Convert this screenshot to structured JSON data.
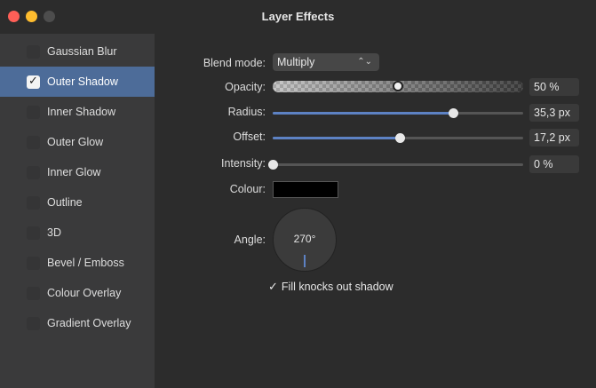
{
  "window": {
    "title": "Layer Effects"
  },
  "sidebar": {
    "items": [
      {
        "label": "Gaussian Blur",
        "checked": false,
        "selected": false
      },
      {
        "label": "Outer Shadow",
        "checked": true,
        "selected": true
      },
      {
        "label": "Inner Shadow",
        "checked": false,
        "selected": false
      },
      {
        "label": "Outer Glow",
        "checked": false,
        "selected": false
      },
      {
        "label": "Inner Glow",
        "checked": false,
        "selected": false
      },
      {
        "label": "Outline",
        "checked": false,
        "selected": false
      },
      {
        "label": "3D",
        "checked": false,
        "selected": false
      },
      {
        "label": "Bevel / Emboss",
        "checked": false,
        "selected": false
      },
      {
        "label": "Colour Overlay",
        "checked": false,
        "selected": false
      },
      {
        "label": "Gradient Overlay",
        "checked": false,
        "selected": false
      }
    ]
  },
  "settings": {
    "blend_mode": {
      "label": "Blend mode:",
      "value": "Multiply"
    },
    "opacity": {
      "label": "Opacity:",
      "value": "50 %",
      "fraction": 0.5
    },
    "radius": {
      "label": "Radius:",
      "value": "35,3 px",
      "fraction": 0.72
    },
    "offset": {
      "label": "Offset:",
      "value": "17,2 px",
      "fraction": 0.51
    },
    "intensity": {
      "label": "Intensity:",
      "value": "0 %",
      "fraction": 0.0
    },
    "colour": {
      "label": "Colour:",
      "value": "#000000"
    },
    "angle": {
      "label": "Angle:",
      "value": "270°"
    },
    "fill_knocks_out": {
      "label": "Fill knocks out shadow",
      "checked": true
    }
  },
  "colors": {
    "accent": "#5d82c4",
    "selection": "#4d6c99",
    "close": "#ff5f57",
    "minimize": "#febc2e"
  }
}
